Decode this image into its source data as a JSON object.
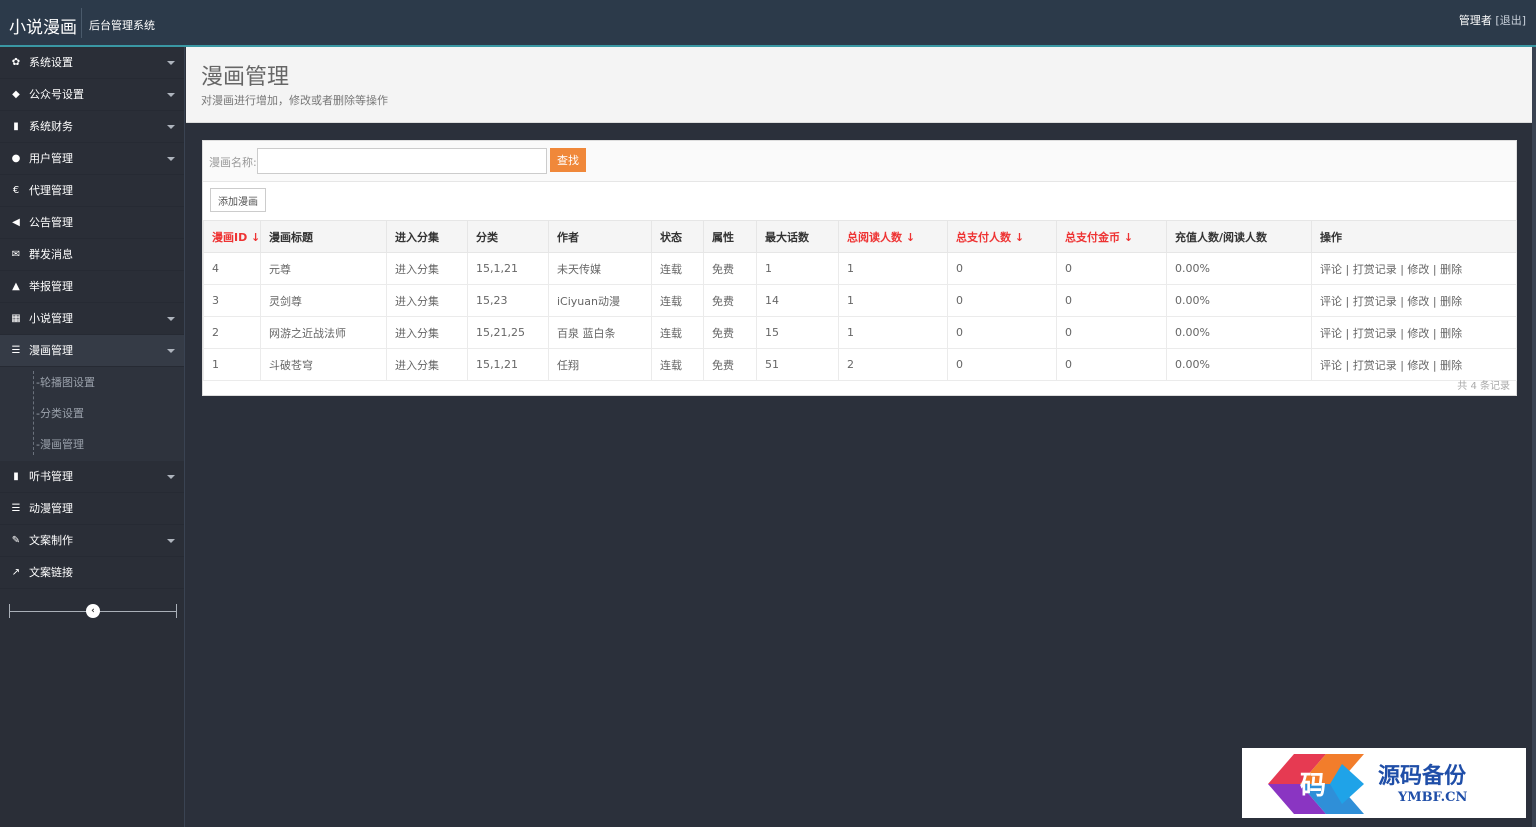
{
  "header": {
    "brand": "小说漫画",
    "subtitle": "后台管理系统",
    "user": "管理者",
    "logout": "[退出]"
  },
  "sidebar": {
    "items": [
      {
        "icon": "gear-icon",
        "glyph": "✿",
        "label": "系统设置",
        "has_caret": true
      },
      {
        "icon": "tag-icon",
        "glyph": "◆",
        "label": "公众号设置",
        "has_caret": true
      },
      {
        "icon": "bar-chart-icon",
        "glyph": "▮",
        "label": "系统财务",
        "has_caret": true
      },
      {
        "icon": "user-icon",
        "glyph": "●",
        "label": "用户管理",
        "has_caret": true
      },
      {
        "icon": "euro-icon",
        "glyph": "€",
        "label": "代理管理",
        "has_caret": false
      },
      {
        "icon": "megaphone-icon",
        "glyph": "◀",
        "label": "公告管理",
        "has_caret": false
      },
      {
        "icon": "envelope-icon",
        "glyph": "✉",
        "label": "群发消息",
        "has_caret": false
      },
      {
        "icon": "warning-icon",
        "glyph": "▲",
        "label": "举报管理",
        "has_caret": false
      },
      {
        "icon": "grid-icon",
        "glyph": "▦",
        "label": "小说管理",
        "has_caret": true
      },
      {
        "icon": "list-icon",
        "glyph": "☰",
        "label": "漫画管理",
        "has_caret": true
      }
    ],
    "sub_items": [
      "-轮播图设置",
      "-分类设置",
      "-漫画管理"
    ],
    "items_after": [
      {
        "icon": "chart-icon",
        "glyph": "▮",
        "label": "听书管理",
        "has_caret": true
      },
      {
        "icon": "list-icon",
        "glyph": "☰",
        "label": "动漫管理",
        "has_caret": false
      },
      {
        "icon": "edit-icon",
        "glyph": "✎",
        "label": "文案制作",
        "has_caret": true
      },
      {
        "icon": "external-link-icon",
        "glyph": "↗",
        "label": "文案链接",
        "has_caret": false
      }
    ],
    "collapse_glyph": "‹"
  },
  "page": {
    "title": "漫画管理",
    "desc": "对漫画进行增加，修改或者删除等操作"
  },
  "search": {
    "label": "漫画名称:",
    "value": "",
    "button": "查找"
  },
  "add_button": "添加漫画",
  "table": {
    "columns": [
      {
        "label": "漫画ID ↓",
        "sort": true,
        "width": 57
      },
      {
        "label": "漫画标题",
        "sort": false,
        "width": 126
      },
      {
        "label": "进入分集",
        "sort": false,
        "width": 81
      },
      {
        "label": "分类",
        "sort": false,
        "width": 81
      },
      {
        "label": "作者",
        "sort": false,
        "width": 103
      },
      {
        "label": "状态",
        "sort": false,
        "width": 52
      },
      {
        "label": "属性",
        "sort": false,
        "width": 53
      },
      {
        "label": "最大话数",
        "sort": false,
        "width": 82
      },
      {
        "label": "总阅读人数 ↓",
        "sort": true,
        "width": 109
      },
      {
        "label": "总支付人数 ↓",
        "sort": true,
        "width": 109
      },
      {
        "label": "总支付金币 ↓",
        "sort": true,
        "width": 110
      },
      {
        "label": "充值人数/阅读人数",
        "sort": false,
        "width": 145
      },
      {
        "label": "操作",
        "sort": false,
        "width": 205
      }
    ],
    "rows": [
      [
        "4",
        "元尊",
        "进入分集",
        "15,1,21",
        "未天传媒",
        "连载",
        "免费",
        "1",
        "1",
        "0",
        "0",
        "0.00%",
        "评论 | 打赏记录 | 修改 | 删除"
      ],
      [
        "3",
        "灵剑尊",
        "进入分集",
        "15,23",
        "iCiyuan动漫",
        "连载",
        "免费",
        "14",
        "1",
        "0",
        "0",
        "0.00%",
        "评论 | 打赏记录 | 修改 | 删除"
      ],
      [
        "2",
        "网游之近战法师",
        "进入分集",
        "15,21,25",
        "百泉 蓝白条",
        "连载",
        "免费",
        "15",
        "1",
        "0",
        "0",
        "0.00%",
        "评论 | 打赏记录 | 修改 | 删除"
      ],
      [
        "1",
        "斗破苍穹",
        "进入分集",
        "15,1,21",
        "任翔",
        "连载",
        "免费",
        "51",
        "2",
        "0",
        "0",
        "0.00%",
        "评论 | 打赏记录 | 修改 | 删除"
      ]
    ],
    "footer": "共 4 条记录"
  },
  "watermark": {
    "logo_char": "码",
    "cn": "源码备份",
    "en": "YMBF.CN"
  },
  "colors": {
    "topbar": "#2c3a4a",
    "sidebar": "#2a2e37",
    "accent_orange": "#f0883a",
    "sort_red": "#e33333",
    "watermark_blue": "#1f4ea8"
  }
}
